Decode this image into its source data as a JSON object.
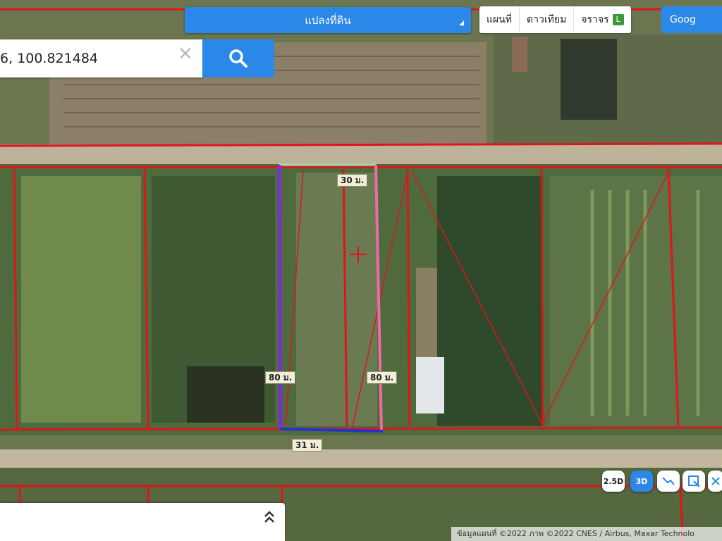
{
  "layer": {
    "label": "แปลงที่ดิน",
    "caret": "◢"
  },
  "map_type": {
    "map": "แผนที่",
    "satellite": "ดาวเทียม",
    "traffic": "จราจร",
    "traffic_icon": "L"
  },
  "google_label": "Goog",
  "search": {
    "value": "6, 100.821484",
    "clear": "✕"
  },
  "measurements": {
    "top": "30 ม.",
    "left": "80 ม.",
    "right": "80 ม.",
    "bottom": "31 ม."
  },
  "controls": {
    "view_2_5d": "2.5D",
    "view_3d": "3D"
  },
  "panel": {
    "chevron": "⌃⌃"
  },
  "attribution": "ข้อมูลแผนที่ ©2022 ภาพ ©2022 CNES / Airbus, Maxar Technolo",
  "colors": {
    "accent": "#2b87e8",
    "parcel_line": "#e0151c",
    "selected_left": "#7a2fd6",
    "selected_right": "#f06aa8",
    "selected_bottom": "#2233cc",
    "selected_top": "#8fe3b0"
  }
}
